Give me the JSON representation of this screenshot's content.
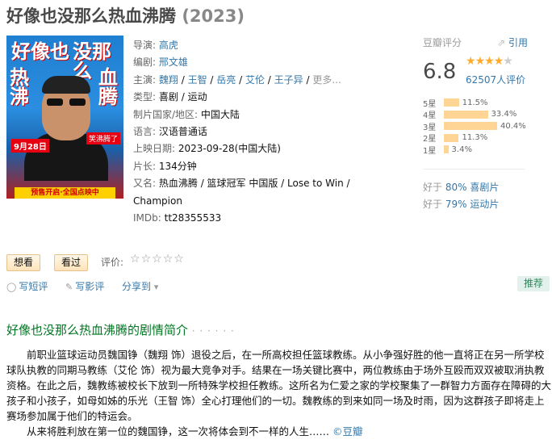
{
  "title": "好像也没那么热血沸腾",
  "year": "(2023)",
  "poster": {
    "text_left": "好像也",
    "text_left2": "热沸",
    "text_right": "没那么",
    "text_right2": "血腾",
    "date": "9月28日",
    "tag": "笑沸腾了",
    "ribbon": "预售开启·全国点映中"
  },
  "info": {
    "director_label": "导演",
    "director": "高虎",
    "writer_label": "编剧",
    "writer": "邢文雄",
    "cast_label": "主演",
    "cast": [
      "魏翔",
      "王智",
      "岳亮",
      "艾伦",
      "王子异"
    ],
    "more": "更多...",
    "genre_label": "类型",
    "genres": [
      "喜剧",
      "运动"
    ],
    "country_label": "制片国家/地区",
    "country": "中国大陆",
    "language_label": "语言",
    "language": "汉语普通话",
    "release_label": "上映日期",
    "release": "2023-09-28(中国大陆)",
    "runtime_label": "片长",
    "runtime": "134分钟",
    "aka_label": "又名",
    "aka_line1": "热血沸腾 / 篮球冠军 中国版 / Lose to Win /",
    "aka_line2": "Champion",
    "imdb_label": "IMDb",
    "imdb": "tt28355533"
  },
  "rating": {
    "label": "豆瓣评分",
    "cite": "引用",
    "score": "6.8",
    "stars_value": 3.5,
    "count": "62507人评价",
    "histogram": [
      {
        "label": "5星",
        "pct": "11.5%",
        "value": 11.5
      },
      {
        "label": "4星",
        "pct": "33.4%",
        "value": 33.4
      },
      {
        "label": "3星",
        "pct": "40.4%",
        "value": 40.4
      },
      {
        "label": "2星",
        "pct": "11.3%",
        "value": 11.3
      },
      {
        "label": "1星",
        "pct": "3.4%",
        "value": 3.4
      }
    ],
    "better1_prefix": "好于",
    "better1_value": "80% 喜剧片",
    "better2_prefix": "好于",
    "better2_value": "79% 运动片"
  },
  "buttons": {
    "want": "想看",
    "seen": "看过",
    "rate_label": "评价:"
  },
  "actions": {
    "short_review": "写短评",
    "review": "写影评",
    "share": "分享到",
    "recommend": "推荐"
  },
  "summary": {
    "heading": "好像也没那么热血沸腾的剧情简介",
    "dots": "· · · · · ·",
    "para1": "前职业篮球运动员魏国铮（魏翔 饰）退役之后，在一所高校担任篮球教练。从小争强好胜的他一直将正在另一所学校球队执教的同期马教练（艾伦 饰）视为最大竞争对手。结果在一场关键比赛中，两位教练由于场外互殴而双双被取消执教资格。在此之后，魏教练被校长下放到一所特殊学校担任教练。这所名为仁爱之家的学校聚集了一群智力方面存在障碍的大孩子和小孩子，如母如姊的乐光（王智 饰）全心打理他们的一切。魏教练的到来如同一场及时雨，因为这群孩子即将走上赛场参加属于他们的特运会。",
    "para2": "从来将胜利放在第一位的魏国铮，这一次将体会到不一样的人生……",
    "copyright": "©豆瓣"
  }
}
